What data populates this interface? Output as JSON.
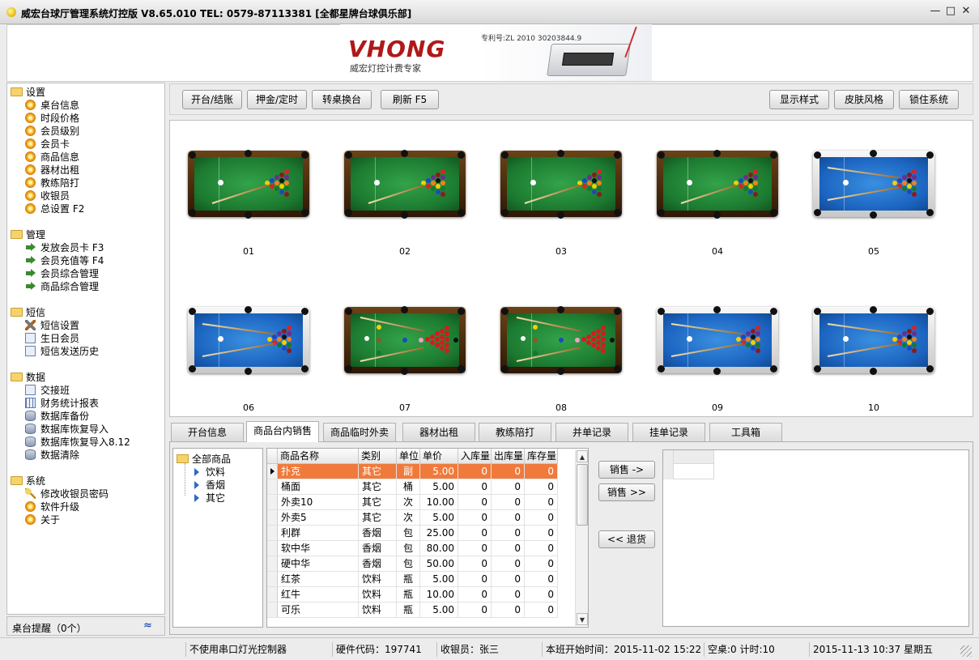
{
  "window": {
    "title": "威宏台球厅管理系统灯控版 V8.65.010   TEL: 0579-87113381  [全都星牌台球俱乐部]",
    "minimize": "—",
    "maximize": "□",
    "close": "✕"
  },
  "banner": {
    "brand": "VHONG",
    "slogan": "威宏灯控计费专家",
    "patent": "专利号:ZL 2010 30203844.9"
  },
  "sidebar": {
    "groups": [
      {
        "label": "设置",
        "items": [
          {
            "label": "桌台信息",
            "icon": "gear-icon"
          },
          {
            "label": "时段价格",
            "icon": "gear-icon"
          },
          {
            "label": "会员级别",
            "icon": "gear-icon"
          },
          {
            "label": "会员卡",
            "icon": "gear-icon"
          },
          {
            "label": "商品信息",
            "icon": "gear-icon"
          },
          {
            "label": "器材出租",
            "icon": "gear-icon"
          },
          {
            "label": "教练陪打",
            "icon": "gear-icon"
          },
          {
            "label": "收银员",
            "icon": "gear-icon"
          },
          {
            "label": "总设置 F2",
            "icon": "gear-icon"
          }
        ]
      },
      {
        "label": "管理",
        "items": [
          {
            "label": "发放会员卡 F3",
            "icon": "arrow-icon"
          },
          {
            "label": "会员充值等 F4",
            "icon": "arrow-icon"
          },
          {
            "label": "会员综合管理",
            "icon": "arrow-icon"
          },
          {
            "label": "商品综合管理",
            "icon": "arrow-icon"
          }
        ]
      },
      {
        "label": "短信",
        "items": [
          {
            "label": "短信设置",
            "icon": "tools-icon"
          },
          {
            "label": "生日会员",
            "icon": "document-icon"
          },
          {
            "label": "短信发送历史",
            "icon": "document-icon"
          }
        ]
      },
      {
        "label": "数据",
        "items": [
          {
            "label": "交接班",
            "icon": "handover-icon"
          },
          {
            "label": "财务统计报表",
            "icon": "report-icon"
          },
          {
            "label": "数据库备份",
            "icon": "database-icon"
          },
          {
            "label": "数据库恢复导入",
            "icon": "database-icon"
          },
          {
            "label": "数据库恢复导入8.12",
            "icon": "database-icon"
          },
          {
            "label": "数据清除",
            "icon": "database-icon"
          }
        ]
      },
      {
        "label": "系统",
        "items": [
          {
            "label": "修改收银员密码",
            "icon": "key-icon"
          },
          {
            "label": "软件升级",
            "icon": "gear-icon"
          },
          {
            "label": "关于",
            "icon": "gear-icon"
          }
        ]
      }
    ],
    "remind": "桌台提醒（0个）",
    "remind_toggle": "≈"
  },
  "toolbar": {
    "open": "开台/结账",
    "deposit": "押金/定时",
    "transfer": "转桌换台",
    "refresh": "刷新 F5",
    "display": "显示样式",
    "skin": "皮肤风格",
    "lock": "锁住系统"
  },
  "tables": [
    {
      "name": "01",
      "style": "green-pool"
    },
    {
      "name": "02",
      "style": "green-pool"
    },
    {
      "name": "03",
      "style": "green-pool"
    },
    {
      "name": "04",
      "style": "green-pool"
    },
    {
      "name": "05",
      "style": "blue-pool"
    },
    {
      "name": "06",
      "style": "blue-pool"
    },
    {
      "name": "07",
      "style": "green-snooker"
    },
    {
      "name": "08",
      "style": "green-snooker"
    },
    {
      "name": "09",
      "style": "blue-pool"
    },
    {
      "name": "10",
      "style": "blue-pool"
    }
  ],
  "tabs": [
    "开台信息",
    "商品台内销售",
    "商品临时外卖",
    "器材出租",
    "教练陪打",
    "并单记录",
    "挂单记录",
    "工具箱"
  ],
  "active_tab": 1,
  "category_tree": {
    "root": "全部商品",
    "children": [
      "饮料",
      "香烟",
      "其它"
    ]
  },
  "goods": {
    "headers": [
      "商品名称",
      "类别",
      "单位",
      "单价",
      "入库量",
      "出库量",
      "库存量"
    ],
    "rows": [
      [
        "扑克",
        "其它",
        "副",
        "5.00",
        "0",
        "0",
        "0"
      ],
      [
        "桶面",
        "其它",
        "桶",
        "5.00",
        "0",
        "0",
        "0"
      ],
      [
        "外卖10",
        "其它",
        "次",
        "10.00",
        "0",
        "0",
        "0"
      ],
      [
        "外卖5",
        "其它",
        "次",
        "5.00",
        "0",
        "0",
        "0"
      ],
      [
        "利群",
        "香烟",
        "包",
        "25.00",
        "0",
        "0",
        "0"
      ],
      [
        "软中华",
        "香烟",
        "包",
        "80.00",
        "0",
        "0",
        "0"
      ],
      [
        "硬中华",
        "香烟",
        "包",
        "50.00",
        "0",
        "0",
        "0"
      ],
      [
        "红茶",
        "饮料",
        "瓶",
        "5.00",
        "0",
        "0",
        "0"
      ],
      [
        "红牛",
        "饮料",
        "瓶",
        "10.00",
        "0",
        "0",
        "0"
      ],
      [
        "可乐",
        "饮料",
        "瓶",
        "5.00",
        "0",
        "0",
        "0"
      ]
    ],
    "selected_row": 0
  },
  "actions": {
    "sell_one": "销售 ->",
    "sell_many": "销售 >>",
    "return": "<< 退货"
  },
  "status": {
    "serial": "不使用串口灯光控制器",
    "hw": "硬件代码：197741",
    "cashier": "收银员：张三",
    "shift": "本班开始时间：2015-11-02 15:22",
    "empty": "空桌:0 计时:10",
    "datetime": "2015-11-13 10:37 星期五"
  }
}
